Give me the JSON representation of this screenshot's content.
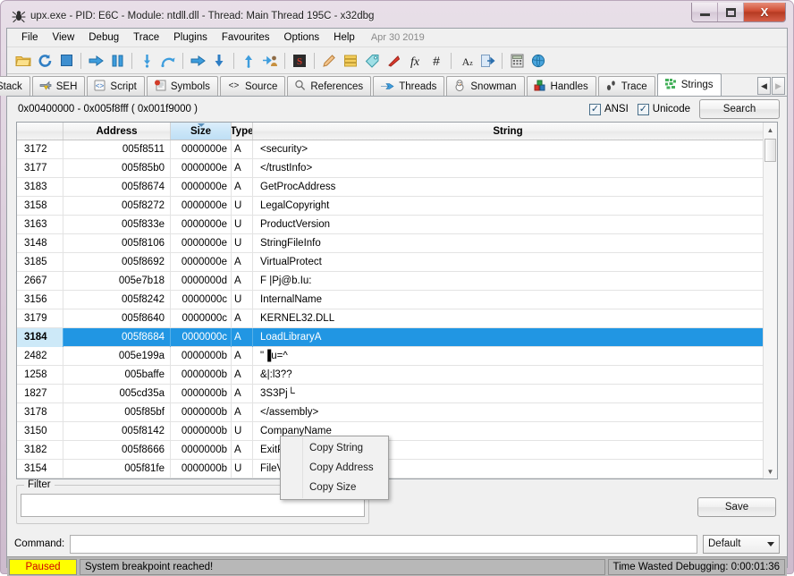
{
  "window": {
    "title": "upx.exe - PID: E6C - Module: ntdll.dll - Thread: Main Thread 195C - x32dbg",
    "minimize_label": "–",
    "maximize_label": "□",
    "close_label": "X"
  },
  "menubar": {
    "items": [
      "File",
      "View",
      "Debug",
      "Trace",
      "Plugins",
      "Favourites",
      "Options",
      "Help"
    ],
    "date": "Apr 30 2019"
  },
  "toolbar": {
    "buttons": [
      {
        "name": "open-icon",
        "tip": "Open"
      },
      {
        "name": "restart-icon",
        "tip": "Restart"
      },
      {
        "name": "stop-icon",
        "tip": "Close"
      },
      {
        "name": "run-icon",
        "tip": "Run"
      },
      {
        "name": "pause-icon",
        "tip": "Pause"
      },
      {
        "name": "step-into-icon",
        "tip": "Step into"
      },
      {
        "name": "step-over-icon",
        "tip": "Step over"
      },
      {
        "name": "execute-till-return-icon",
        "tip": "Execute till return"
      },
      {
        "name": "step-down-icon",
        "tip": "Step"
      },
      {
        "name": "step-up-icon",
        "tip": "Step up"
      },
      {
        "name": "run-to-user-code-icon",
        "tip": "Run to user code"
      },
      {
        "name": "scylla-icon",
        "tip": "Scylla"
      },
      {
        "name": "pencil-icon",
        "tip": "Patch"
      },
      {
        "name": "log-icon",
        "tip": "Log"
      },
      {
        "name": "tag-icon",
        "tip": "Notes"
      },
      {
        "name": "bookmark-icon",
        "tip": "Bookmark"
      },
      {
        "name": "fx-icon",
        "tip": "Functions"
      },
      {
        "name": "hash-icon",
        "tip": "Hash"
      },
      {
        "name": "az-icon",
        "tip": "Sort"
      },
      {
        "name": "exec-icon",
        "tip": "Execute"
      },
      {
        "name": "calculator-icon",
        "tip": "Calculator"
      },
      {
        "name": "globe-icon",
        "tip": "Globe"
      }
    ]
  },
  "tabs": [
    {
      "label": "Stack",
      "icon": "stack-icon",
      "active": false,
      "cut": true
    },
    {
      "label": "SEH",
      "icon": "seh-icon",
      "active": false
    },
    {
      "label": "Script",
      "icon": "script-icon",
      "active": false
    },
    {
      "label": "Symbols",
      "icon": "symbols-icon",
      "active": false
    },
    {
      "label": "Source",
      "icon": "source-icon",
      "active": false
    },
    {
      "label": "References",
      "icon": "references-icon",
      "active": false
    },
    {
      "label": "Threads",
      "icon": "threads-icon",
      "active": false
    },
    {
      "label": "Snowman",
      "icon": "snowman-icon",
      "active": false
    },
    {
      "label": "Handles",
      "icon": "handles-icon",
      "active": false
    },
    {
      "label": "Trace",
      "icon": "trace-icon",
      "active": false
    },
    {
      "label": "Strings",
      "icon": "strings-icon",
      "active": true
    }
  ],
  "tab_scroll": {
    "left": "◀",
    "right": "▶"
  },
  "strings_panel": {
    "range": "0x00400000 - 0x005f8fff ( 0x001f9000 )",
    "ansi_label": "ANSI",
    "ansi_checked": true,
    "unicode_label": "Unicode",
    "unicode_checked": true,
    "search_label": "Search",
    "columns": [
      "",
      "Address",
      "Size",
      "Type",
      "String"
    ],
    "sorted_column": "Size",
    "rows": [
      {
        "index": "3172",
        "address": "005f8511",
        "size": "0000000e",
        "type": "A",
        "string": "<security>",
        "selected": false
      },
      {
        "index": "3177",
        "address": "005f85b0",
        "size": "0000000e",
        "type": "A",
        "string": "</trustInfo>",
        "selected": false
      },
      {
        "index": "3183",
        "address": "005f8674",
        "size": "0000000e",
        "type": "A",
        "string": "GetProcAddress",
        "selected": false
      },
      {
        "index": "3158",
        "address": "005f8272",
        "size": "0000000e",
        "type": "U",
        "string": "LegalCopyright",
        "selected": false
      },
      {
        "index": "3163",
        "address": "005f833e",
        "size": "0000000e",
        "type": "U",
        "string": "ProductVersion",
        "selected": false
      },
      {
        "index": "3148",
        "address": "005f8106",
        "size": "0000000e",
        "type": "U",
        "string": "StringFileInfo",
        "selected": false
      },
      {
        "index": "3185",
        "address": "005f8692",
        "size": "0000000e",
        "type": "A",
        "string": "VirtualProtect",
        "selected": false
      },
      {
        "index": "2667",
        "address": "005e7b18",
        "size": "0000000d",
        "type": "A",
        "string": "F |P\u0006j@b.▾Iu:",
        "selected": false
      },
      {
        "index": "3156",
        "address": "005f8242",
        "size": "0000000c",
        "type": "U",
        "string": "InternalName",
        "selected": false
      },
      {
        "index": "3179",
        "address": "005f8640",
        "size": "0000000c",
        "type": "A",
        "string": "KERNEL32.DLL",
        "selected": false
      },
      {
        "index": "3184",
        "address": "005f8684",
        "size": "0000000c",
        "type": "A",
        "string": "LoadLibraryA",
        "selected": true
      },
      {
        "index": "2482",
        "address": "005e199a",
        "size": "0000000b",
        "type": "A",
        "string": "\"▐u=^",
        "selected": false
      },
      {
        "index": "1258",
        "address": "005baffe",
        "size": "0000000b",
        "type": "A",
        "string": "&|:l3??",
        "selected": false
      },
      {
        "index": "1827",
        "address": "005cd35a",
        "size": "0000000b",
        "type": "A",
        "string": "3S3Pj└",
        "selected": false
      },
      {
        "index": "3178",
        "address": "005f85bf",
        "size": "0000000b",
        "type": "A",
        "string": "</assembly>",
        "selected": false
      },
      {
        "index": "3150",
        "address": "005f8142",
        "size": "0000000b",
        "type": "U",
        "string": "CompanyName",
        "selected": false
      },
      {
        "index": "3182",
        "address": "005f8666",
        "size": "0000000b",
        "type": "A",
        "string": "ExitProcess",
        "selected": false
      },
      {
        "index": "3154",
        "address": "005f81fe",
        "size": "0000000b",
        "type": "U",
        "string": "FileVersion",
        "selected": false
      }
    ]
  },
  "context_menu": {
    "items": [
      "Copy String",
      "Copy Address",
      "Copy Size"
    ]
  },
  "filter": {
    "legend": "Filter",
    "value": "",
    "placeholder": ""
  },
  "save_button": "Save",
  "command": {
    "label": "Command:",
    "value": "",
    "placeholder": "",
    "mode": "Default"
  },
  "statusbar": {
    "state": "Paused",
    "message": "System breakpoint reached!",
    "timer": "Time Wasted Debugging: 0:00:01:36"
  },
  "colors": {
    "selection": "#2196e3",
    "selection_index": "#cde9f8",
    "paused_bg": "#ffff00",
    "paused_fg": "#d00000",
    "sorted_header": "#cbe6f8"
  }
}
